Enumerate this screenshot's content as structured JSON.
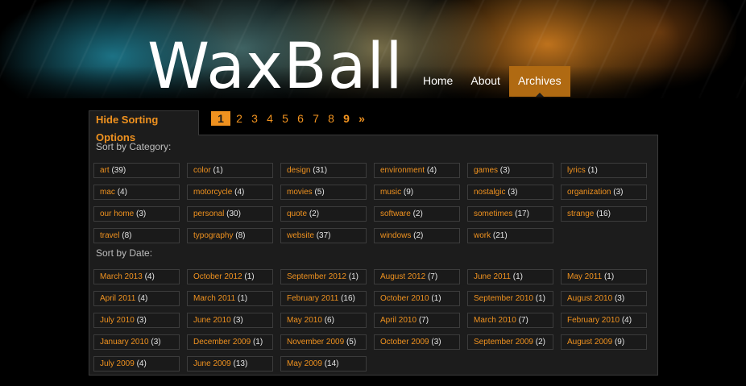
{
  "site": {
    "logo": "WaxBall"
  },
  "nav": [
    {
      "label": "Home",
      "active": false
    },
    {
      "label": "About",
      "active": false
    },
    {
      "label": "Archives",
      "active": true
    }
  ],
  "sorting": {
    "toggle_label": "Hide Sorting Options"
  },
  "pagination": {
    "pages": [
      "1",
      "2",
      "3",
      "4",
      "5",
      "6",
      "7",
      "8",
      "9"
    ],
    "current": "1",
    "next": "»"
  },
  "categories_label": "Sort by Category:",
  "categories": [
    {
      "name": "art",
      "count": "(39)"
    },
    {
      "name": "color",
      "count": "(1)"
    },
    {
      "name": "design",
      "count": "(31)"
    },
    {
      "name": "environment",
      "count": "(4)"
    },
    {
      "name": "games",
      "count": "(3)"
    },
    {
      "name": "lyrics",
      "count": "(1)"
    },
    {
      "name": "mac",
      "count": "(4)"
    },
    {
      "name": "motorcycle",
      "count": "(4)"
    },
    {
      "name": "movies",
      "count": "(5)"
    },
    {
      "name": "music",
      "count": "(9)"
    },
    {
      "name": "nostalgic",
      "count": "(3)"
    },
    {
      "name": "organization",
      "count": "(3)"
    },
    {
      "name": "our home",
      "count": "(3)"
    },
    {
      "name": "personal",
      "count": "(30)"
    },
    {
      "name": "quote",
      "count": "(2)"
    },
    {
      "name": "software",
      "count": "(2)"
    },
    {
      "name": "sometimes",
      "count": "(17)"
    },
    {
      "name": "strange",
      "count": "(16)"
    },
    {
      "name": "travel",
      "count": "(8)"
    },
    {
      "name": "typography",
      "count": "(8)"
    },
    {
      "name": "website",
      "count": "(37)"
    },
    {
      "name": "windows",
      "count": "(2)"
    },
    {
      "name": "work",
      "count": "(21)"
    }
  ],
  "dates_label": "Sort by Date:",
  "dates": [
    {
      "name": "March 2013",
      "count": "(4)"
    },
    {
      "name": "October 2012",
      "count": "(1)"
    },
    {
      "name": "September 2012",
      "count": "(1)"
    },
    {
      "name": "August 2012",
      "count": "(7)"
    },
    {
      "name": "June 2011",
      "count": "(1)"
    },
    {
      "name": "May 2011",
      "count": "(1)"
    },
    {
      "name": "April 2011",
      "count": "(4)"
    },
    {
      "name": "March 2011",
      "count": "(1)"
    },
    {
      "name": "February 2011",
      "count": "(16)"
    },
    {
      "name": "October 2010",
      "count": "(1)"
    },
    {
      "name": "September 2010",
      "count": "(1)"
    },
    {
      "name": "August 2010",
      "count": "(3)"
    },
    {
      "name": "July 2010",
      "count": "(3)"
    },
    {
      "name": "June 2010",
      "count": "(3)"
    },
    {
      "name": "May 2010",
      "count": "(6)"
    },
    {
      "name": "April 2010",
      "count": "(7)"
    },
    {
      "name": "March 2010",
      "count": "(7)"
    },
    {
      "name": "February 2010",
      "count": "(4)"
    },
    {
      "name": "January 2010",
      "count": "(3)"
    },
    {
      "name": "December 2009",
      "count": "(1)"
    },
    {
      "name": "November 2009",
      "count": "(5)"
    },
    {
      "name": "October 2009",
      "count": "(3)"
    },
    {
      "name": "September 2009",
      "count": "(2)"
    },
    {
      "name": "August 2009",
      "count": "(9)"
    },
    {
      "name": "July 2009",
      "count": "(4)"
    },
    {
      "name": "June 2009",
      "count": "(13)"
    },
    {
      "name": "May 2009",
      "count": "(14)"
    }
  ],
  "colors": {
    "accent": "#f0921f",
    "nav_active": "#b06a12",
    "panel_bg": "#1c1c1c"
  }
}
